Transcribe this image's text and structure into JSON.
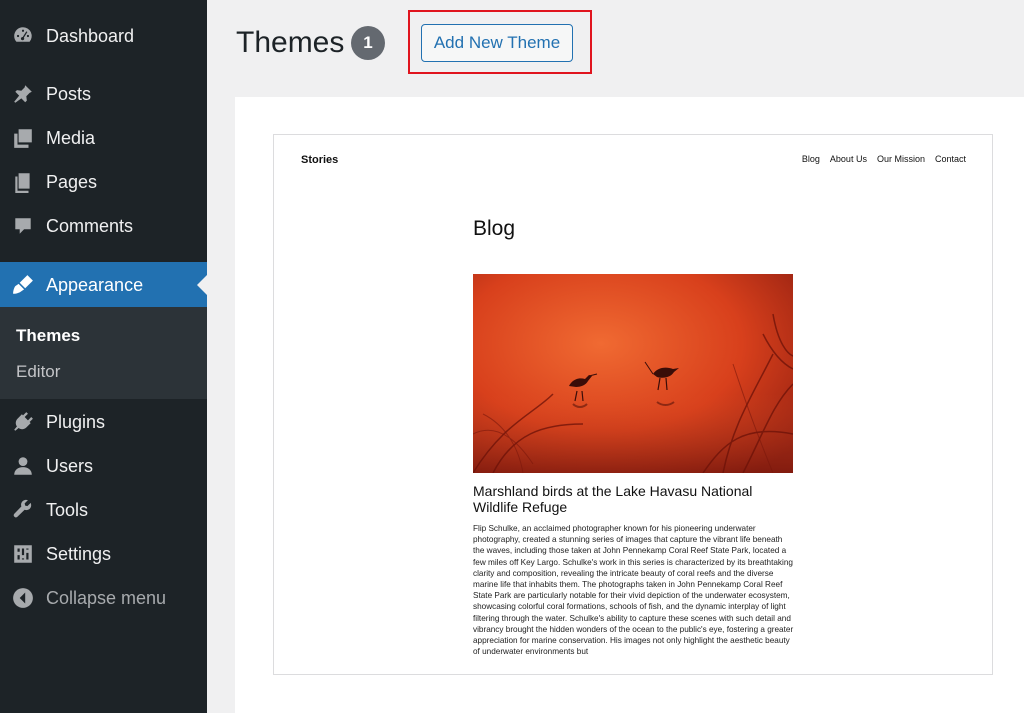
{
  "sidebar": {
    "items": [
      {
        "label": "Dashboard",
        "icon": "dashboard-icon"
      },
      {
        "label": "Posts",
        "icon": "pin-icon"
      },
      {
        "label": "Media",
        "icon": "media-icon"
      },
      {
        "label": "Pages",
        "icon": "pages-icon"
      },
      {
        "label": "Comments",
        "icon": "comment-icon"
      },
      {
        "label": "Appearance",
        "icon": "brush-icon",
        "active": true
      },
      {
        "label": "Plugins",
        "icon": "plugin-icon"
      },
      {
        "label": "Users",
        "icon": "user-icon"
      },
      {
        "label": "Tools",
        "icon": "wrench-icon"
      },
      {
        "label": "Settings",
        "icon": "settings-icon"
      },
      {
        "label": "Collapse menu",
        "icon": "collapse-icon"
      }
    ],
    "submenu": [
      {
        "label": "Themes",
        "current": true
      },
      {
        "label": "Editor"
      }
    ]
  },
  "header": {
    "title": "Themes",
    "count": "1",
    "add_button": "Add New Theme"
  },
  "preview": {
    "site_title": "Stories",
    "nav": [
      "Blog",
      "About Us",
      "Our Mission",
      "Contact"
    ],
    "heading": "Blog",
    "post_title": "Marshland birds at the Lake Havasu National Wildlife Refuge",
    "post_body": "Flip Schulke, an acclaimed photographer known for his pioneering underwater photography, created a stunning series of images that capture the vibrant life beneath the waves, including those taken at John Pennekamp Coral Reef State Park, located a few miles off Key Largo. Schulke's work in this series is characterized by its breathtaking clarity and composition, revealing the intricate beauty of coral reefs and the diverse marine life that inhabits them. The photographs taken in John Pennekamp Coral Reef State Park are particularly notable for their vivid depiction of the underwater ecosystem, showcasing colorful coral formations, schools of fish, and the dynamic interplay of light filtering through the water. Schulke's ability to capture these scenes with such detail and vibrancy brought the hidden wonders of the ocean to the public's eye, fostering a greater appreciation for marine conservation. His images not only highlight the aesthetic beauty of underwater environments but"
  },
  "colors": {
    "sidebar_bg": "#1d2327",
    "accent": "#2271b1",
    "highlight": "#e0141e"
  }
}
